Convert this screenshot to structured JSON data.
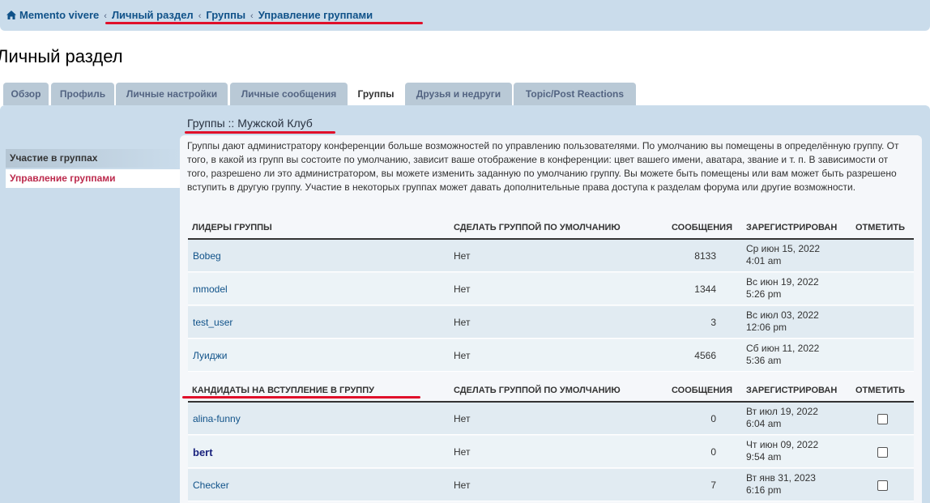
{
  "breadcrumb": {
    "home": "Memento vivere",
    "items": [
      "Личный раздел",
      "Группы",
      "Управление группами"
    ]
  },
  "page_title": "Личный раздел",
  "tabs": [
    "Обзор",
    "Профиль",
    "Личные настройки",
    "Личные сообщения",
    "Группы",
    "Друзья и недруги",
    "Topic/Post Reactions"
  ],
  "active_tab": "Группы",
  "sidebar": {
    "items": [
      "Участие в группах",
      "Управление группами"
    ]
  },
  "group_title": "Группы :: Мужской Клуб",
  "description": "Группы дают администратору конференции больше возможностей по управлению пользователями. По умолчанию вы помещены в определённую группу. От того, в какой из групп вы состоите по умолчанию, зависит ваше отображение в конференции: цвет вашего имени, аватара, звание и т. п. В зависимости от того, разрешено ли это администратором, вы можете изменить заданную по умолчанию группу. Вы можете быть помещены или вам может быть разрешено вступить в другую группу. Участие в некоторых группах может давать дополнительные права доступа к разделам форума или другие возможности.",
  "leaders_table": {
    "headers": [
      "Лидеры группы",
      "Сделать группой по умолчанию",
      "Сообщения",
      "Зарегистрирован",
      "Отметить"
    ],
    "rows": [
      {
        "user": "Bobeg",
        "default": "Нет",
        "posts": "8133",
        "date1": "Ср июн 15, 2022",
        "date2": "4:01 am"
      },
      {
        "user": "mmodel",
        "default": "Нет",
        "posts": "1344",
        "date1": "Вс июн 19, 2022",
        "date2": "5:26 pm"
      },
      {
        "user": "test_user",
        "default": "Нет",
        "posts": "3",
        "date1": "Вс июл 03, 2022",
        "date2": "12:06 pm"
      },
      {
        "user": "Луиджи",
        "default": "Нет",
        "posts": "4566",
        "date1": "Сб июн 11, 2022",
        "date2": "5:36 am"
      }
    ]
  },
  "candidates_table": {
    "headers": [
      "Кандидаты на вступление в группу",
      "Сделать группой по умолчанию",
      "Сообщения",
      "Зарегистрирован",
      "Отметить"
    ],
    "rows": [
      {
        "user": "alina-funny",
        "default": "Нет",
        "posts": "0",
        "date1": "Вт июл 19, 2022",
        "date2": "6:04 am"
      },
      {
        "user": "bert",
        "default": "Нет",
        "posts": "0",
        "date1": "Чт июн 09, 2022",
        "date2": "9:54 am"
      },
      {
        "user": "Checker",
        "default": "Нет",
        "posts": "7",
        "date1": "Вт янв 31, 2023",
        "date2": "6:16 pm"
      }
    ]
  },
  "colors": {
    "link": "#105289",
    "panel": "#cadceb",
    "annotation": "#e0102a",
    "active_side": "#bc2a4d"
  }
}
